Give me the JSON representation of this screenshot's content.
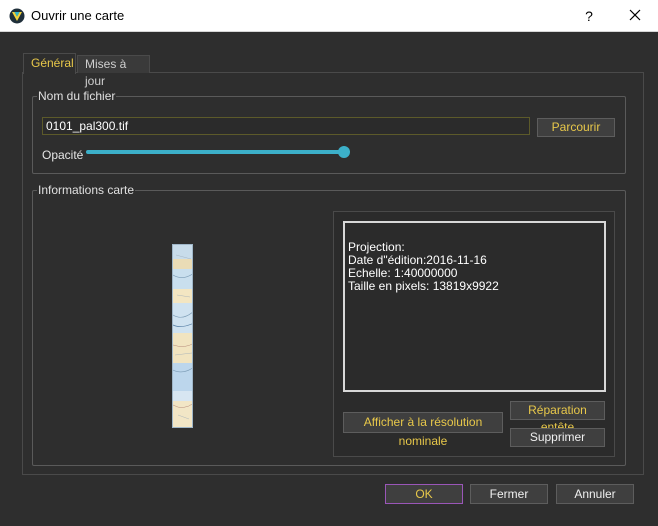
{
  "window": {
    "title": "Ouvrir une carte",
    "help_glyph": "?",
    "close_glyph": "✕",
    "app_icon": "app-logo-icon"
  },
  "tabs": [
    {
      "label": "Général",
      "active": true
    },
    {
      "label": "Mises à jour",
      "active": false
    }
  ],
  "file_group": {
    "legend": "Nom du fichier",
    "filename_value": "0101_pal300.tif",
    "browse_label": "Parcourir",
    "opacity_label": "Opacité",
    "opacity_value": 1.0
  },
  "info_group": {
    "legend": "Informations carte",
    "info_lines": [
      "Projection:",
      "Date d\"édition:2016-11-16",
      "Echelle: 1:40000000",
      "Taille en pixels: 13819x9922"
    ],
    "afficher_label": "Afficher à la résolution nominale",
    "reparation_label": "Réparation entête",
    "supprimer_label": "Supprimer"
  },
  "footer": {
    "ok_label": "OK",
    "fermer_label": "Fermer",
    "annuler_label": "Annuler"
  },
  "colors": {
    "accent_text": "#e8c84a",
    "slider": "#3cb0c9",
    "ok_border": "#9a56b8",
    "background": "#2e2e2e"
  }
}
